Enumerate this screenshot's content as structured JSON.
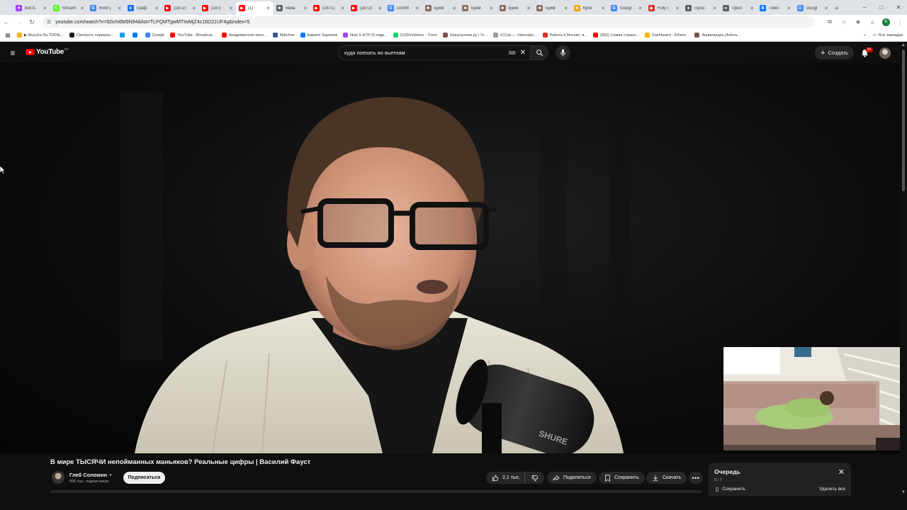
{
  "browser": {
    "tabs": [
      {
        "label": "Bot.lс",
        "color": "#a142f4",
        "glyph": "♥"
      },
      {
        "label": "Stream",
        "color": "#53fc18",
        "glyph": "K"
      },
      {
        "label": "6500 j",
        "color": "#4285f4",
        "glyph": "G"
      },
      {
        "label": "Граф",
        "color": "#1a73e8",
        "glyph": "e"
      },
      {
        "label": "(1872)",
        "color": "#ff0000",
        "glyph": "▶"
      },
      {
        "label": "(187)",
        "color": "#ff0000",
        "glyph": "▶"
      },
      {
        "label": "(1)",
        "color": "#ff0000",
        "glyph": "▶",
        "active": true
      },
      {
        "label": "Авиа",
        "color": "#5f6368",
        "glyph": "■"
      },
      {
        "label": "(1871)",
        "color": "#ff0000",
        "glyph": "▶"
      },
      {
        "label": "(1872)",
        "color": "#ff0000",
        "glyph": "▶"
      },
      {
        "label": "GISMI",
        "color": "#4285f4",
        "glyph": "G"
      },
      {
        "label": "Букм",
        "color": "#8d6e63",
        "glyph": "■"
      },
      {
        "label": "Букм",
        "color": "#8d6e63",
        "glyph": "■"
      },
      {
        "label": "Букм",
        "color": "#8d6e63",
        "glyph": "■"
      },
      {
        "label": "Букм",
        "color": "#8d6e63",
        "glyph": "■"
      },
      {
        "label": "Купи",
        "color": "#f4a300",
        "glyph": "■"
      },
      {
        "label": "Googl",
        "color": "#4285f4",
        "glyph": "G"
      },
      {
        "label": "Fully l",
        "color": "#d93025",
        "glyph": "◆"
      },
      {
        "label": "Проо",
        "color": "#5f6368",
        "glyph": "●"
      },
      {
        "label": "Проо",
        "color": "#5f6368",
        "glyph": "●"
      },
      {
        "label": "Томо",
        "color": "#0077ff",
        "glyph": "В"
      },
      {
        "label": "Googl",
        "color": "#4285f4",
        "glyph": "G"
      }
    ],
    "url": "youtube.com/watch?v=92icN6M9N94&list=TLPQMTgwMTIwMjZ4c16D21UF4g&index=5",
    "profile_initial": "K",
    "bookmarks": [
      {
        "label": "▶ Muzyka Na TOPIE...",
        "color": "#f4b400"
      },
      {
        "label": "Смотреть сериалы...",
        "color": "#202124"
      },
      {
        "label": "",
        "color": "#1d9bf0"
      },
      {
        "label": "",
        "color": "#0077ff"
      },
      {
        "label": "Google",
        "color": "#4285f4"
      },
      {
        "label": "YouTube - Broadcas...",
        "color": "#ff0000"
      },
      {
        "label": "Неадекватное прох...",
        "color": "#ff0000"
      },
      {
        "label": "Matches",
        "color": "#3c5a99"
      },
      {
        "label": "Кирилл Зырянов",
        "color": "#0077ff"
      },
      {
        "label": "Now 5-HTP (5-гидр...",
        "color": "#a142f4"
      },
      {
        "label": "(1)XKrekHoro - Trovo",
        "color": "#19d66b"
      },
      {
        "label": "Шашлычник.ру | Ус...",
        "color": "#795548"
      },
      {
        "label": "iCCup — Internatio...",
        "color": "#9e9e9e"
      },
      {
        "label": "Работа в Москве, в...",
        "color": "#d93025"
      },
      {
        "label": "(562) Самая странн...",
        "color": "#ff0000"
      },
      {
        "label": "Dashboard - Ethere...",
        "color": "#f4b400"
      },
      {
        "label": "Ашвагандха (Ashva...",
        "color": "#795548"
      }
    ],
    "all_bookmarks": "Все закладки"
  },
  "youtube": {
    "logo": "YouTube",
    "region": "BY",
    "search_query": "куда поехать во вьетнам",
    "create_label": "Создать",
    "notif_badge": "9+"
  },
  "video": {
    "title": "В мире ТЫСЯЧИ непойманных маньяков? Реальные цифры | Василий Фауст",
    "channel_name": "Глеб Соломин",
    "subscribers": "995 тыс. подписчиков",
    "subscribe_label": "Подписаться",
    "likes": "2,1 тыс.",
    "share_label": "Поделиться",
    "save_label": "Сохранить",
    "download_label": "Скачать",
    "mic_brand": "SHURE"
  },
  "queue": {
    "title": "Очередь",
    "count": "5 / 7",
    "save_label": "Сохранить",
    "clear_label": "Удалить все"
  }
}
